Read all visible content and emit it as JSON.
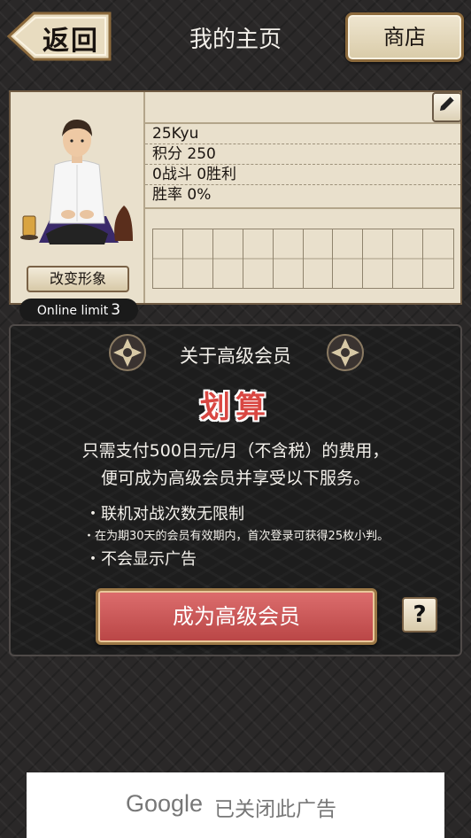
{
  "header": {
    "back_label": "返回",
    "title": "我的主页",
    "shop_label": "商店"
  },
  "profile": {
    "name": "",
    "change_avatar_label": "改变形象",
    "online_limit_label": "Online limit",
    "online_limit_value": "3",
    "stats": [
      "25Kyu",
      "积分 250",
      "0战斗 0胜利",
      "胜率 0%"
    ],
    "history_cells": 10
  },
  "membership": {
    "title": "关于高级会员",
    "bargain": "划算",
    "description_line1": "只需支付500日元/月（不含税）的费用，",
    "description_line2": "便可成为高级会员并享受以下服务。",
    "benefit1": "・联机对战次数无限制",
    "benefit1_note": "・在为期30天的会员有效期内，首次登录可获得25枚小判。",
    "benefit2": "・不会显示广告",
    "become_button": "成为高级会员",
    "help_symbol": "?"
  },
  "ad": {
    "brand": "Google",
    "message": "已关闭此广告"
  },
  "colors": {
    "accent_red": "#d94742",
    "card_bg": "#e9e0cc",
    "button_gold_border": "#9c7846"
  }
}
